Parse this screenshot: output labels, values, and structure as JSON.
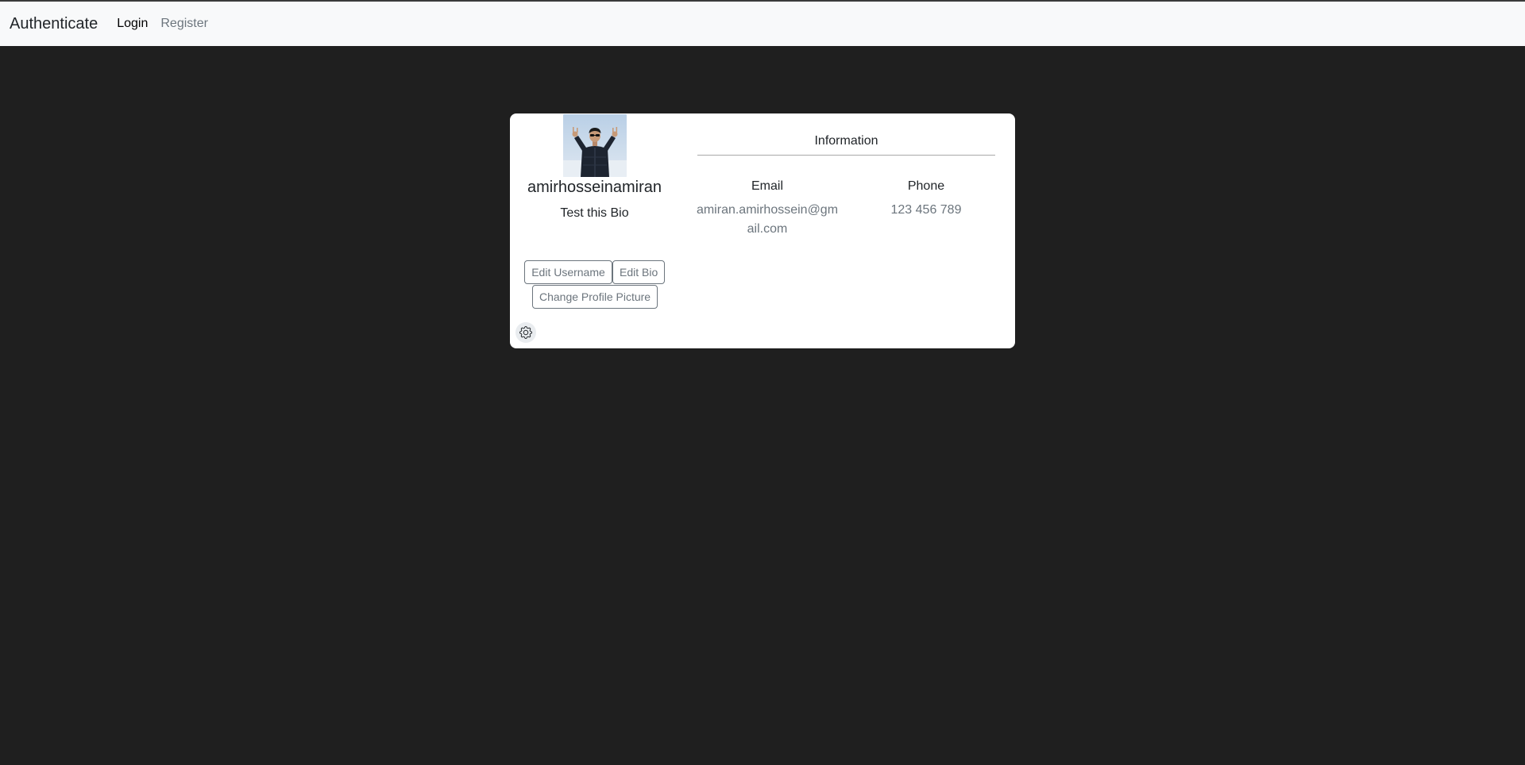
{
  "navbar": {
    "brand": "Authenticate",
    "links": [
      {
        "label": "Login",
        "active": true
      },
      {
        "label": "Register",
        "active": false
      }
    ]
  },
  "profile": {
    "username": "amirhosseinamiran",
    "bio": "Test this Bio",
    "buttons": {
      "edit_username": "Edit Username",
      "edit_bio": "Edit Bio",
      "change_picture": "Change Profile Picture"
    },
    "settings_icon": "gear-icon"
  },
  "information": {
    "title": "Information",
    "email_label": "Email",
    "email_value": "amiran.amirhossein@gmail.com",
    "phone_label": "Phone",
    "phone_value": "123 456 789"
  },
  "colors": {
    "page_background": "#1f1f1f",
    "navbar_background": "#f8f9fa",
    "card_background": "#ffffff",
    "muted_text": "#6c757d"
  }
}
